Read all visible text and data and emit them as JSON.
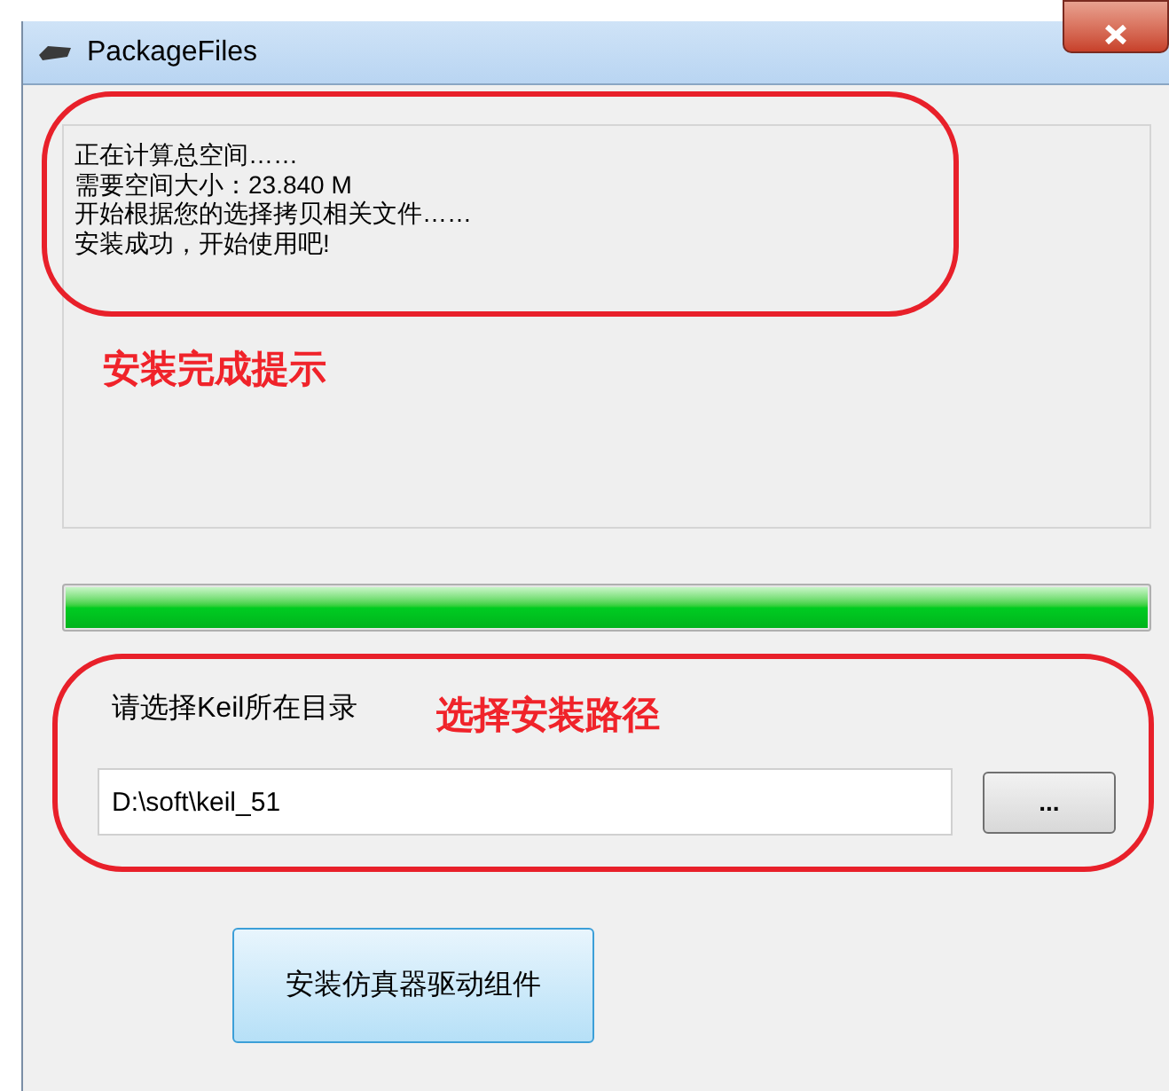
{
  "window": {
    "title": "PackageFiles"
  },
  "log": {
    "lines": [
      "正在计算总空间……",
      "需要空间大小：23.840 M",
      "开始根据您的选择拷贝相关文件……",
      "安装成功，开始使用吧!"
    ]
  },
  "annotations": [
    {
      "text": "安装完成提示"
    },
    {
      "text": "选择安装路径"
    }
  ],
  "progress": {
    "level": 1
  },
  "path": {
    "label": "请选择Keil所在目录",
    "value": "D:\\soft\\keil_51",
    "browse_button": "..."
  },
  "install_button": "安装仿真器驱动组件"
}
